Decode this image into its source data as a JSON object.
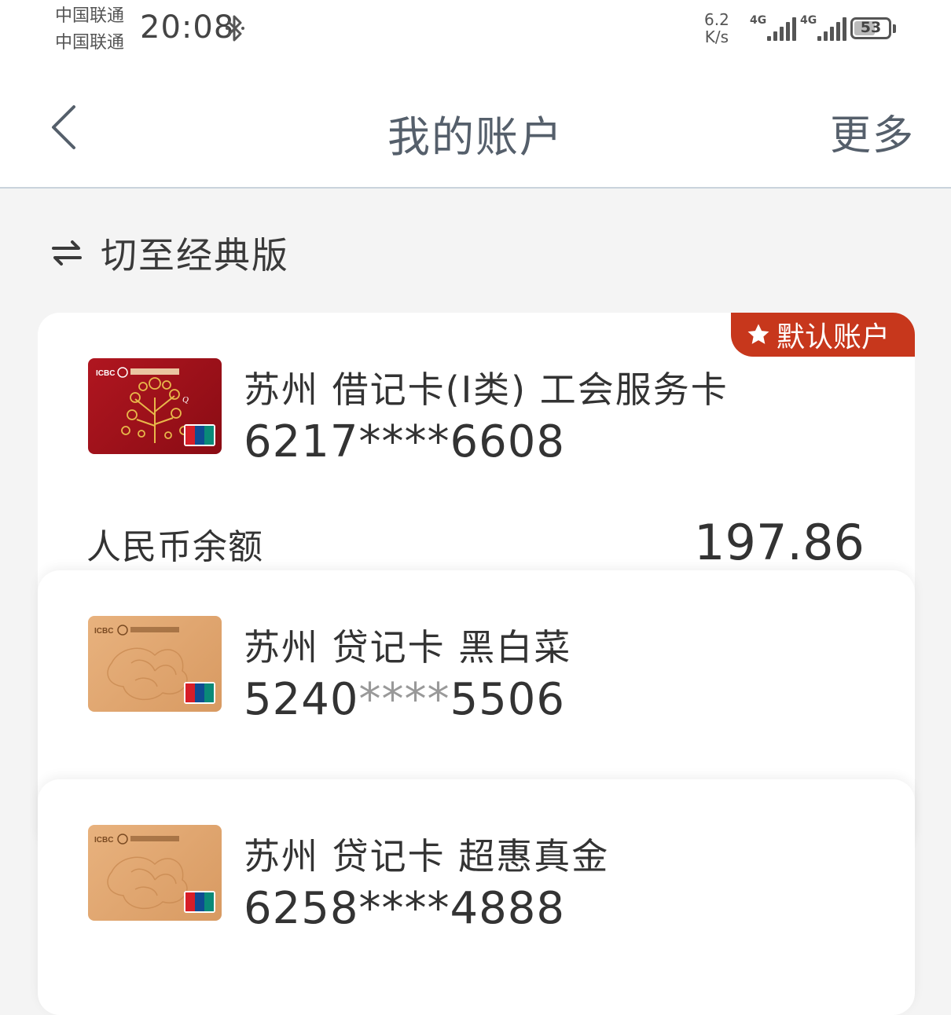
{
  "status": {
    "carrier1": "中国联通",
    "carrier2": "中国联通",
    "time": "20:08",
    "bluetooth_icon": "bluetooth-icon",
    "speed_value": "6.2",
    "speed_unit": "K/s",
    "sim1_type": "4G",
    "sim2_type": "4G",
    "battery": "53"
  },
  "nav": {
    "title": "我的账户",
    "more": "更多",
    "back_icon": "chevron-left-icon"
  },
  "switch": {
    "label": "切至经典版",
    "icon": "swap-icon"
  },
  "default_badge": "默认账户",
  "accounts": [
    {
      "name": "苏州 借记卡(I类) 工会服务卡",
      "num_prefix": "6217",
      "num_mask": "****",
      "num_suffix": "6608",
      "balance_label": "人民币余额",
      "balance": "197.86",
      "card_color": "#a51019"
    },
    {
      "name": "苏州 贷记卡 黑白菜",
      "num_prefix": "5240",
      "num_mask": "****",
      "num_suffix": "5506",
      "card_color": "#e0a56e"
    },
    {
      "name": "苏州 贷记卡 超惠真金",
      "num_prefix": "6258",
      "num_mask": "****",
      "num_suffix": "4888",
      "card_color": "#e0a56e"
    }
  ],
  "colors": {
    "accent_red": "#c7371c",
    "nav_text": "#555f6b",
    "background": "#f4f4f4"
  }
}
